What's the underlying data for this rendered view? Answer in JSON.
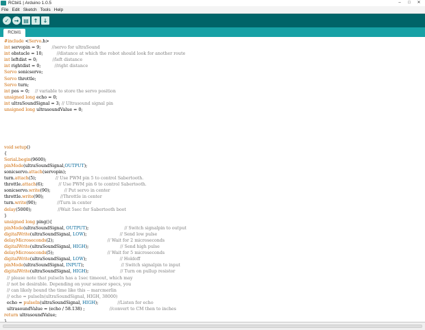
{
  "window": {
    "title": "RCbil1 | Arduino 1.0.5",
    "controls": [
      "–",
      "□",
      "✕"
    ]
  },
  "menu": [
    "File",
    "Edit",
    "Sketch",
    "Tools",
    "Help"
  ],
  "toolbar": {
    "buttons": [
      {
        "name": "verify",
        "glyph": "✓",
        "shape": "round"
      },
      {
        "name": "upload",
        "glyph": "→",
        "shape": "round"
      },
      {
        "name": "new",
        "glyph": "▤",
        "shape": "square"
      },
      {
        "name": "open",
        "glyph": "↑",
        "shape": "square"
      },
      {
        "name": "save",
        "glyph": "↓",
        "shape": "square"
      }
    ]
  },
  "tabs": [
    {
      "label": "RCbil1"
    }
  ],
  "colors": {
    "toolbar": "#006468",
    "tabbar": "#17a1a5",
    "keyword": "#cc6600",
    "type": "#cc6600",
    "comment": "#7e7e7e",
    "constant": "#006699"
  },
  "code_lines": [
    "#include <Servo.h>",
    "int servopin = 9;        //servo for ultraSound",
    "int obstacle = 10;          //distance at which the robot should look for another route",
    "int leftdist = 0;           //left distance",
    "int rightdist = 0;          //right distance",
    "Servo sonicservo;",
    "Servo throttle;",
    "Servo turn;",
    "int pos = 0;    // variable to store the servo position",
    "unsigned long echo = 0;",
    "int ultraSoundSignal = 3; // Ultrasound signal pin",
    "unsigned long ultrasoundValue = 0;",
    "",
    "",
    "",
    "",
    "",
    "void setup()",
    "{",
    "Serial.begin(9600);",
    "pinMode(ultraSoundSignal,OUTPUT);",
    "sonicservo.attach(servopin);",
    "turn.attach(5);              // Use PWM pin 5 to control Sabertooth.",
    "throttle.attach(6);           // Use PWM pin 6 to control Sabertooth.",
    "sonicservo.write(90);          // Put servo in center",
    "throttle.write(90);            //Throttle in center",
    "turn.write(90);               //Turn in center",
    "delay(5000);                   //Wait 5sec for Sabertooth boot",
    "}",
    "unsigned long ping(){",
    "pinMode(ultraSoundSignal, OUTPUT);                          // Switch signalpin to output",
    "digitalWrite(ultraSoundSignal, LOW);                        // Send low pulse",
    "delayMicroseconds(2);                                       // Wait for 2 microseconds",
    "digitalWrite(ultraSoundSignal, HIGH);                       // Send high pulse",
    "delayMicroseconds(5);                                       // Wait for 5 microseconds",
    "digitalWrite(ultraSoundSignal, LOW);                        // Holdoff",
    "pinMode(ultraSoundSignal, INPUT);                           // Switch signalpin to input",
    "digitalWrite(ultraSoundSignal, HIGH);                       // Turn on pullup resistor",
    "  // please note that pulseIn has a 1sec timeout, which may",
    "  // not be desirable. Depending on your sensor specs, you",
    "  // can likely bound the time like this -- marcmerlin",
    "  // echo = pulseIn(ultraSoundSignal, HIGH, 38000)",
    "  echo = pulseIn(ultraSoundSignal, HIGH);              //Listen for echo",
    "  ultrasoundValue = (echo / 58.138) ;                  //convert to CM then to inches",
    "return ultrasoundValue;",
    "}"
  ]
}
